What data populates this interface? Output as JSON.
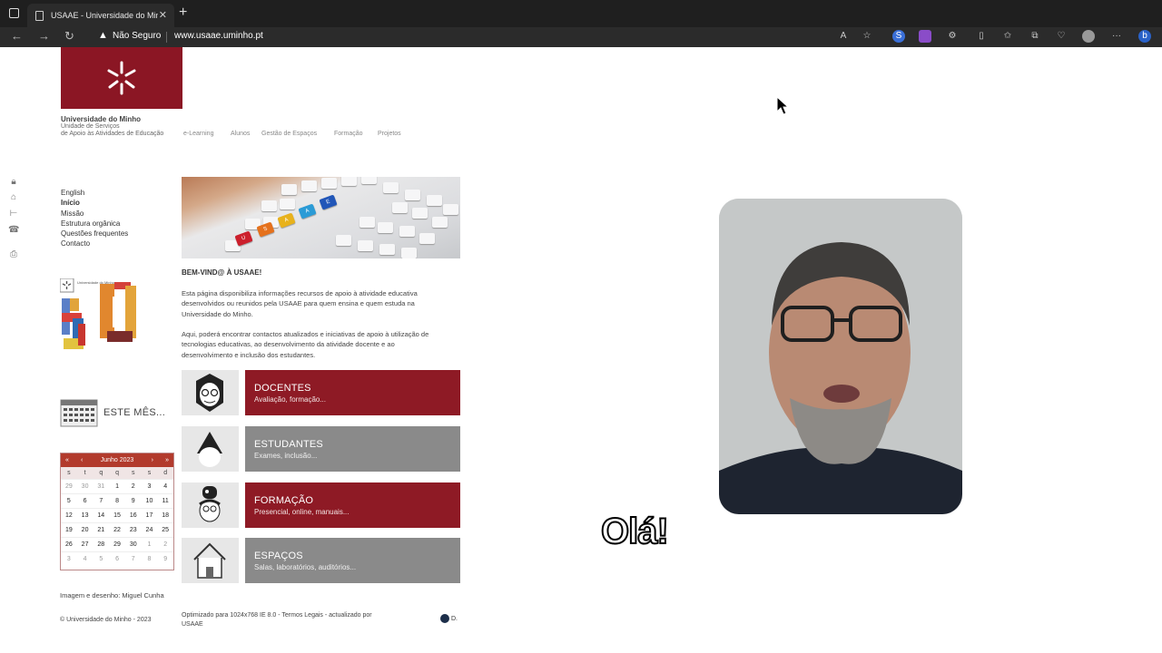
{
  "browser": {
    "tab_title": "USAAE - Universidade do Minho",
    "security_label": "Não Seguro",
    "url": "www.usaae.uminho.pt"
  },
  "site": {
    "university_name": "Universidade do Minho",
    "unit_line1": "Unidade de Serviços",
    "unit_line2": "de Apoio às Atividades de Educação",
    "topnav": [
      "e-Learning",
      "Alunos",
      "Gestão de Espaços",
      "Formação",
      "Projetos"
    ],
    "sidemenu": [
      "English",
      "Início",
      "Missão",
      "Estrutura orgânica",
      "Questões frequentes",
      "Contacto"
    ],
    "anniversary_logo_text": "Universidade do Minho",
    "este_mes": "ESTE MÊS...",
    "credit": "Imagem e desenho: Miguel Cunha",
    "copyright": "© Universidade do Minho - 2023"
  },
  "calendar": {
    "month": "Junho 2023",
    "nav": {
      "prev_year": "«",
      "prev": "‹",
      "next": "›",
      "next_year": "»"
    },
    "dow": [
      "s",
      "t",
      "q",
      "q",
      "s",
      "s",
      "d"
    ],
    "weeks": [
      [
        "29",
        "30",
        "31",
        "1",
        "2",
        "3",
        "4"
      ],
      [
        "5",
        "6",
        "7",
        "8",
        "9",
        "10",
        "11"
      ],
      [
        "12",
        "13",
        "14",
        "15",
        "16",
        "17",
        "18"
      ],
      [
        "19",
        "20",
        "21",
        "22",
        "23",
        "24",
        "25"
      ],
      [
        "26",
        "27",
        "28",
        "29",
        "30",
        "1",
        "2"
      ],
      [
        "3",
        "4",
        "5",
        "6",
        "7",
        "8",
        "9"
      ]
    ]
  },
  "main": {
    "banner_keys": [
      "U",
      "S",
      "A",
      "A",
      "E"
    ],
    "welcome_title": "BEM-VIND@ À USAAE!",
    "paragraph1": "Esta página disponibiliza informações recursos de apoio à atividade educativa desenvolvidos ou reunidos pela USAAE para quem ensina e quem estuda na Universidade do Minho.",
    "paragraph2": "Aqui, poderá encontrar contactos atualizados e iniciativas de apoio à utilização de tecnologias educativas, ao desenvolvimento da atividade docente e ao desenvolvimento e inclusão dos estudantes.",
    "cards": [
      {
        "title": "DOCENTES",
        "subtitle": "Avaliação, formação..."
      },
      {
        "title": "ESTUDANTES",
        "subtitle": "Exames, inclusão..."
      },
      {
        "title": "FORMAÇÃO",
        "subtitle": "Presencial, online, manuais..."
      },
      {
        "title": "ESPAÇOS",
        "subtitle": "Salas, laboratórios, auditórios..."
      }
    ],
    "footer": "Optimizado para 1024x768 IE 8.0  - Termos Legais  - actualizado por USAAE",
    "footer_logo": "D."
  },
  "overlay": {
    "subtitle": "Olá!"
  },
  "colors": {
    "brand_red": "#8e1a25",
    "card_grey": "#8a8a8a",
    "calendar_red": "#b23a2c"
  }
}
